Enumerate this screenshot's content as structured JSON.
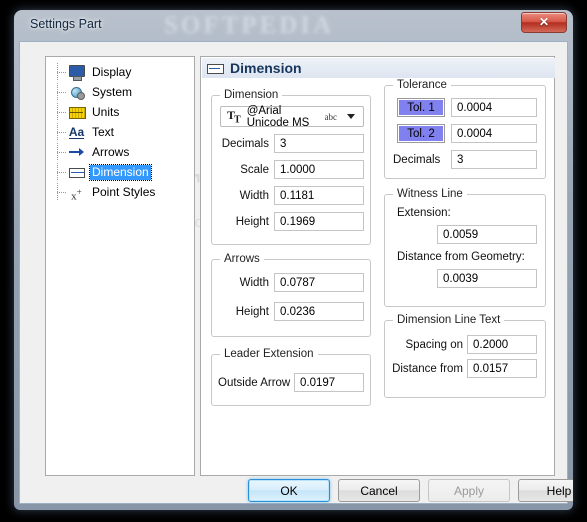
{
  "window": {
    "title": "Settings Part",
    "close_label": "✕",
    "watermark": "SOFTPEDIA",
    "watermark_tm": "™",
    "watermark_sub": "www.softpedia.com"
  },
  "sidebar": {
    "items": [
      {
        "label": "Display",
        "icon": "monitor-icon",
        "selected": false
      },
      {
        "label": "System",
        "icon": "system-sphere-icon",
        "selected": false
      },
      {
        "label": "Units",
        "icon": "ruler-icon",
        "selected": false
      },
      {
        "label": "Text",
        "icon": "text-aa-icon",
        "selected": false
      },
      {
        "label": "Arrows",
        "icon": "arrow-icon",
        "selected": false
      },
      {
        "label": "Dimension",
        "icon": "dimension-icon",
        "selected": true
      },
      {
        "label": "Point Styles",
        "icon": "point-styles-icon",
        "selected": false
      }
    ]
  },
  "content": {
    "header": {
      "title": "Dimension",
      "icon": "dimension-icon"
    },
    "dimension_group": {
      "title": "Dimension",
      "font": {
        "icon": "font-tt-icon",
        "name": "@Arial Unicode MS",
        "preview": "abc",
        "chevron": "chevron-down-icon"
      },
      "fields": [
        {
          "label": "Decimals",
          "value": "3"
        },
        {
          "label": "Scale",
          "value": "1.0000"
        },
        {
          "label": "Width",
          "value": "0.1181"
        },
        {
          "label": "Height",
          "value": "0.1969"
        }
      ]
    },
    "arrows_group": {
      "title": "Arrows",
      "fields": [
        {
          "label": "Width",
          "value": "0.0787"
        },
        {
          "label": "Height",
          "value": "0.0236"
        }
      ]
    },
    "leader_group": {
      "title": "Leader Extension",
      "fields": [
        {
          "label": "Outside Arrow",
          "value": "0.0197"
        }
      ]
    },
    "tolerance_group": {
      "title": "Tolerance",
      "tol1_label": "Tol. 1",
      "tol1_value": "0.0004",
      "tol2_label": "Tol. 2",
      "tol2_value": "0.0004",
      "decimals_label": "Decimals",
      "decimals_value": "3"
    },
    "witness_group": {
      "title": "Witness Line",
      "extension_label": "Extension:",
      "extension_value": "0.0059",
      "distance_label": "Distance from Geometry:",
      "distance_value": "0.0039"
    },
    "dimline_group": {
      "title": "Dimension Line Text",
      "fields": [
        {
          "label": "Spacing on",
          "value": "0.2000"
        },
        {
          "label": "Distance from",
          "value": "0.0157"
        }
      ]
    }
  },
  "footer": {
    "ok": "OK",
    "cancel": "Cancel",
    "apply": "Apply",
    "help": "Help"
  },
  "colors": {
    "selection_blue": "#3399ff",
    "tolerance_button": "#8080ef",
    "header_title": "#17365d",
    "close_red": "#b22d20"
  }
}
